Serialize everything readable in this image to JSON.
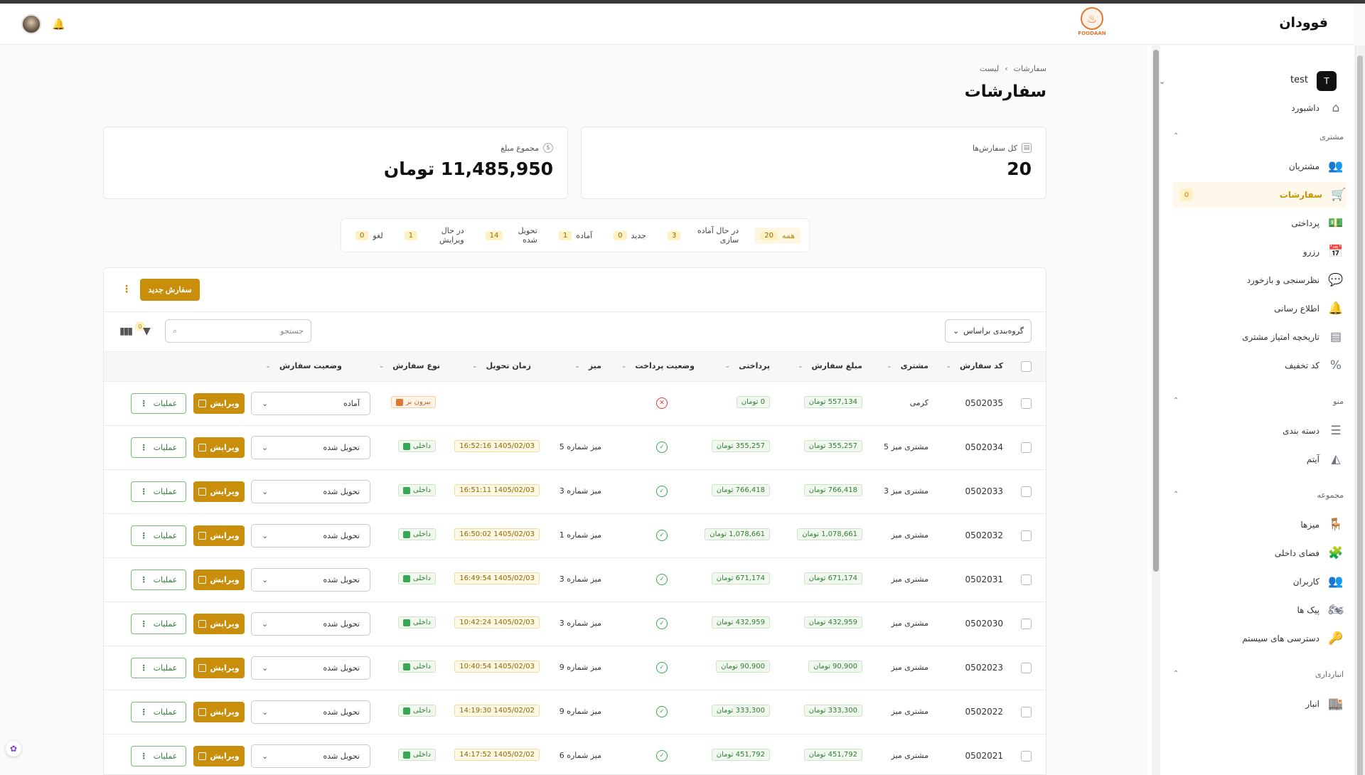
{
  "app": {
    "name": "فوودان",
    "logo_text": "FOODAAN"
  },
  "header": {
    "bell_icon": "bell-icon",
    "avatar_icon": "user-avatar"
  },
  "sidebar": {
    "user": {
      "initial": "T",
      "name": "test"
    },
    "items_top": [
      {
        "label": "داشبورد",
        "icon": "home-icon",
        "glyph": "⌂"
      }
    ],
    "sections": [
      {
        "title": "مشتری",
        "items": [
          {
            "label": "مشتریان",
            "icon": "users-icon",
            "glyph": "👥"
          },
          {
            "label": "سفارشات",
            "icon": "cart-icon",
            "glyph": "🛒",
            "active": true,
            "count": "0"
          },
          {
            "label": "پرداختی",
            "icon": "money-icon",
            "glyph": "💵"
          },
          {
            "label": "رزرو",
            "icon": "calendar-icon",
            "glyph": "📅"
          },
          {
            "label": "نظرسنجی و بازخورد",
            "icon": "chat-icon",
            "glyph": "💬"
          },
          {
            "label": "اطلاع رسانی",
            "icon": "bell-icon",
            "glyph": "🔔"
          },
          {
            "label": "تاریخچه امتیاز مشتری",
            "icon": "archive-icon",
            "glyph": "▤"
          },
          {
            "label": "کد تخفیف",
            "icon": "percent-icon",
            "glyph": "%"
          }
        ]
      },
      {
        "title": "منو",
        "items": [
          {
            "label": "دسته بندی",
            "icon": "list-icon",
            "glyph": "☰"
          },
          {
            "label": "آیتم",
            "icon": "pizza-icon",
            "glyph": "◭"
          }
        ]
      },
      {
        "title": "مجموعه",
        "items": [
          {
            "label": "میزها",
            "icon": "chair-icon",
            "glyph": "🪑"
          },
          {
            "label": "فضای داخلی",
            "icon": "puzzle-icon",
            "glyph": "🧩"
          },
          {
            "label": "کاربران",
            "icon": "users-icon",
            "glyph": "👥"
          },
          {
            "label": "پیک ها",
            "icon": "motorcycle-icon",
            "glyph": "🏍"
          },
          {
            "label": "دسترسی های سیستم",
            "icon": "key-icon",
            "glyph": "🔑"
          }
        ]
      },
      {
        "title": "انبارداری",
        "items": [
          {
            "label": "انبار",
            "icon": "warehouse-icon",
            "glyph": "🏬"
          }
        ]
      }
    ]
  },
  "breadcrumb": {
    "root": "سفارشات",
    "current": "لیست",
    "separator": "›"
  },
  "page_title": "سفارشات",
  "stats": {
    "total_orders": {
      "label": "کل سفارش‌ها",
      "value": "20"
    },
    "total_amount": {
      "label": "مجموع مبلغ",
      "value": "11,485,950 تومان"
    }
  },
  "status_filters": [
    {
      "label": "همه",
      "count": "20",
      "active": true
    },
    {
      "label": "در حال آماده سازی",
      "count": "3"
    },
    {
      "label": "جدید",
      "count": "0"
    },
    {
      "label": "آماده",
      "count": "1"
    },
    {
      "label": "تحویل شده",
      "count": "14"
    },
    {
      "label": "در حال ویرایش",
      "count": "1"
    },
    {
      "label": "لغو",
      "count": "0"
    }
  ],
  "toolbar": {
    "new_order_label": "سفارش جدید",
    "group_by_label": "گروه‌بندی براساس",
    "search_placeholder": "جستجو",
    "filter_count": "0"
  },
  "columns": {
    "code": "کد سفارش",
    "customer": "مشتری",
    "amount": "مبلغ سفارش",
    "paid": "پرداختی",
    "payment_status": "وضعیت پرداخت",
    "table": "میز",
    "delivery_time": "زمان تحویل",
    "order_type": "نوع سفارش",
    "order_status": "وضعیت سفارش"
  },
  "row_actions": {
    "edit_label": "ویرایش",
    "ops_label": "عملیات"
  },
  "orders": [
    {
      "code": "0502035",
      "customer": "کرمی",
      "amount": "557,134 تومان",
      "paid": "0 تومان",
      "paid_ok": false,
      "table": "",
      "time": "",
      "type": "بیرون بر",
      "type_kind": "takeaway",
      "status": "آماده"
    },
    {
      "code": "0502034",
      "customer": "مشتری میز 5",
      "amount": "355,257 تومان",
      "paid": "355,257 تومان",
      "paid_ok": true,
      "table": "میز شماره 5",
      "time": "1405/02/03 16:52:16",
      "type": "داخلی",
      "type_kind": "dinein",
      "status": "تحویل شده"
    },
    {
      "code": "0502033",
      "customer": "مشتری میز 3",
      "amount": "766,418 تومان",
      "paid": "766,418 تومان",
      "paid_ok": true,
      "table": "میز شماره 3",
      "time": "1405/02/03 16:51:11",
      "type": "داخلی",
      "type_kind": "dinein",
      "status": "تحویل شده"
    },
    {
      "code": "0502032",
      "customer": "مشتری میز",
      "amount": "1,078,661 تومان",
      "paid": "1,078,661 تومان",
      "paid_ok": true,
      "table": "میز شماره 1",
      "time": "1405/02/03 16:50:02",
      "type": "داخلی",
      "type_kind": "dinein",
      "status": "تحویل شده"
    },
    {
      "code": "0502031",
      "customer": "مشتری میز",
      "amount": "671,174 تومان",
      "paid": "671,174 تومان",
      "paid_ok": true,
      "table": "میز شماره 3",
      "time": "1405/02/03 16:49:54",
      "type": "داخلی",
      "type_kind": "dinein",
      "status": "تحویل شده"
    },
    {
      "code": "0502030",
      "customer": "مشتری میز",
      "amount": "432,959 تومان",
      "paid": "432,959 تومان",
      "paid_ok": true,
      "table": "میز شماره 3",
      "time": "1405/02/03 10:42:24",
      "type": "داخلی",
      "type_kind": "dinein",
      "status": "تحویل شده"
    },
    {
      "code": "0502023",
      "customer": "مشتری میز",
      "amount": "90,900 تومان",
      "paid": "90,900 تومان",
      "paid_ok": true,
      "table": "میز شماره 9",
      "time": "1405/02/03 10:40:54",
      "type": "داخلی",
      "type_kind": "dinein",
      "status": "تحویل شده"
    },
    {
      "code": "0502022",
      "customer": "مشتری میز",
      "amount": "333,300 تومان",
      "paid": "333,300 تومان",
      "paid_ok": true,
      "table": "میز شماره 9",
      "time": "1405/02/02 14:19:30",
      "type": "داخلی",
      "type_kind": "dinein",
      "status": "تحویل شده"
    },
    {
      "code": "0502021",
      "customer": "مشتری میز",
      "amount": "451,792 تومان",
      "paid": "451,792 تومان",
      "paid_ok": true,
      "table": "میز شماره 6",
      "time": "1405/02/02 14:17:52",
      "type": "داخلی",
      "type_kind": "dinein",
      "status": "تحویل شده"
    }
  ],
  "colors": {
    "accent": "#c98f0c",
    "success": "#34a853",
    "danger": "#e53935"
  }
}
